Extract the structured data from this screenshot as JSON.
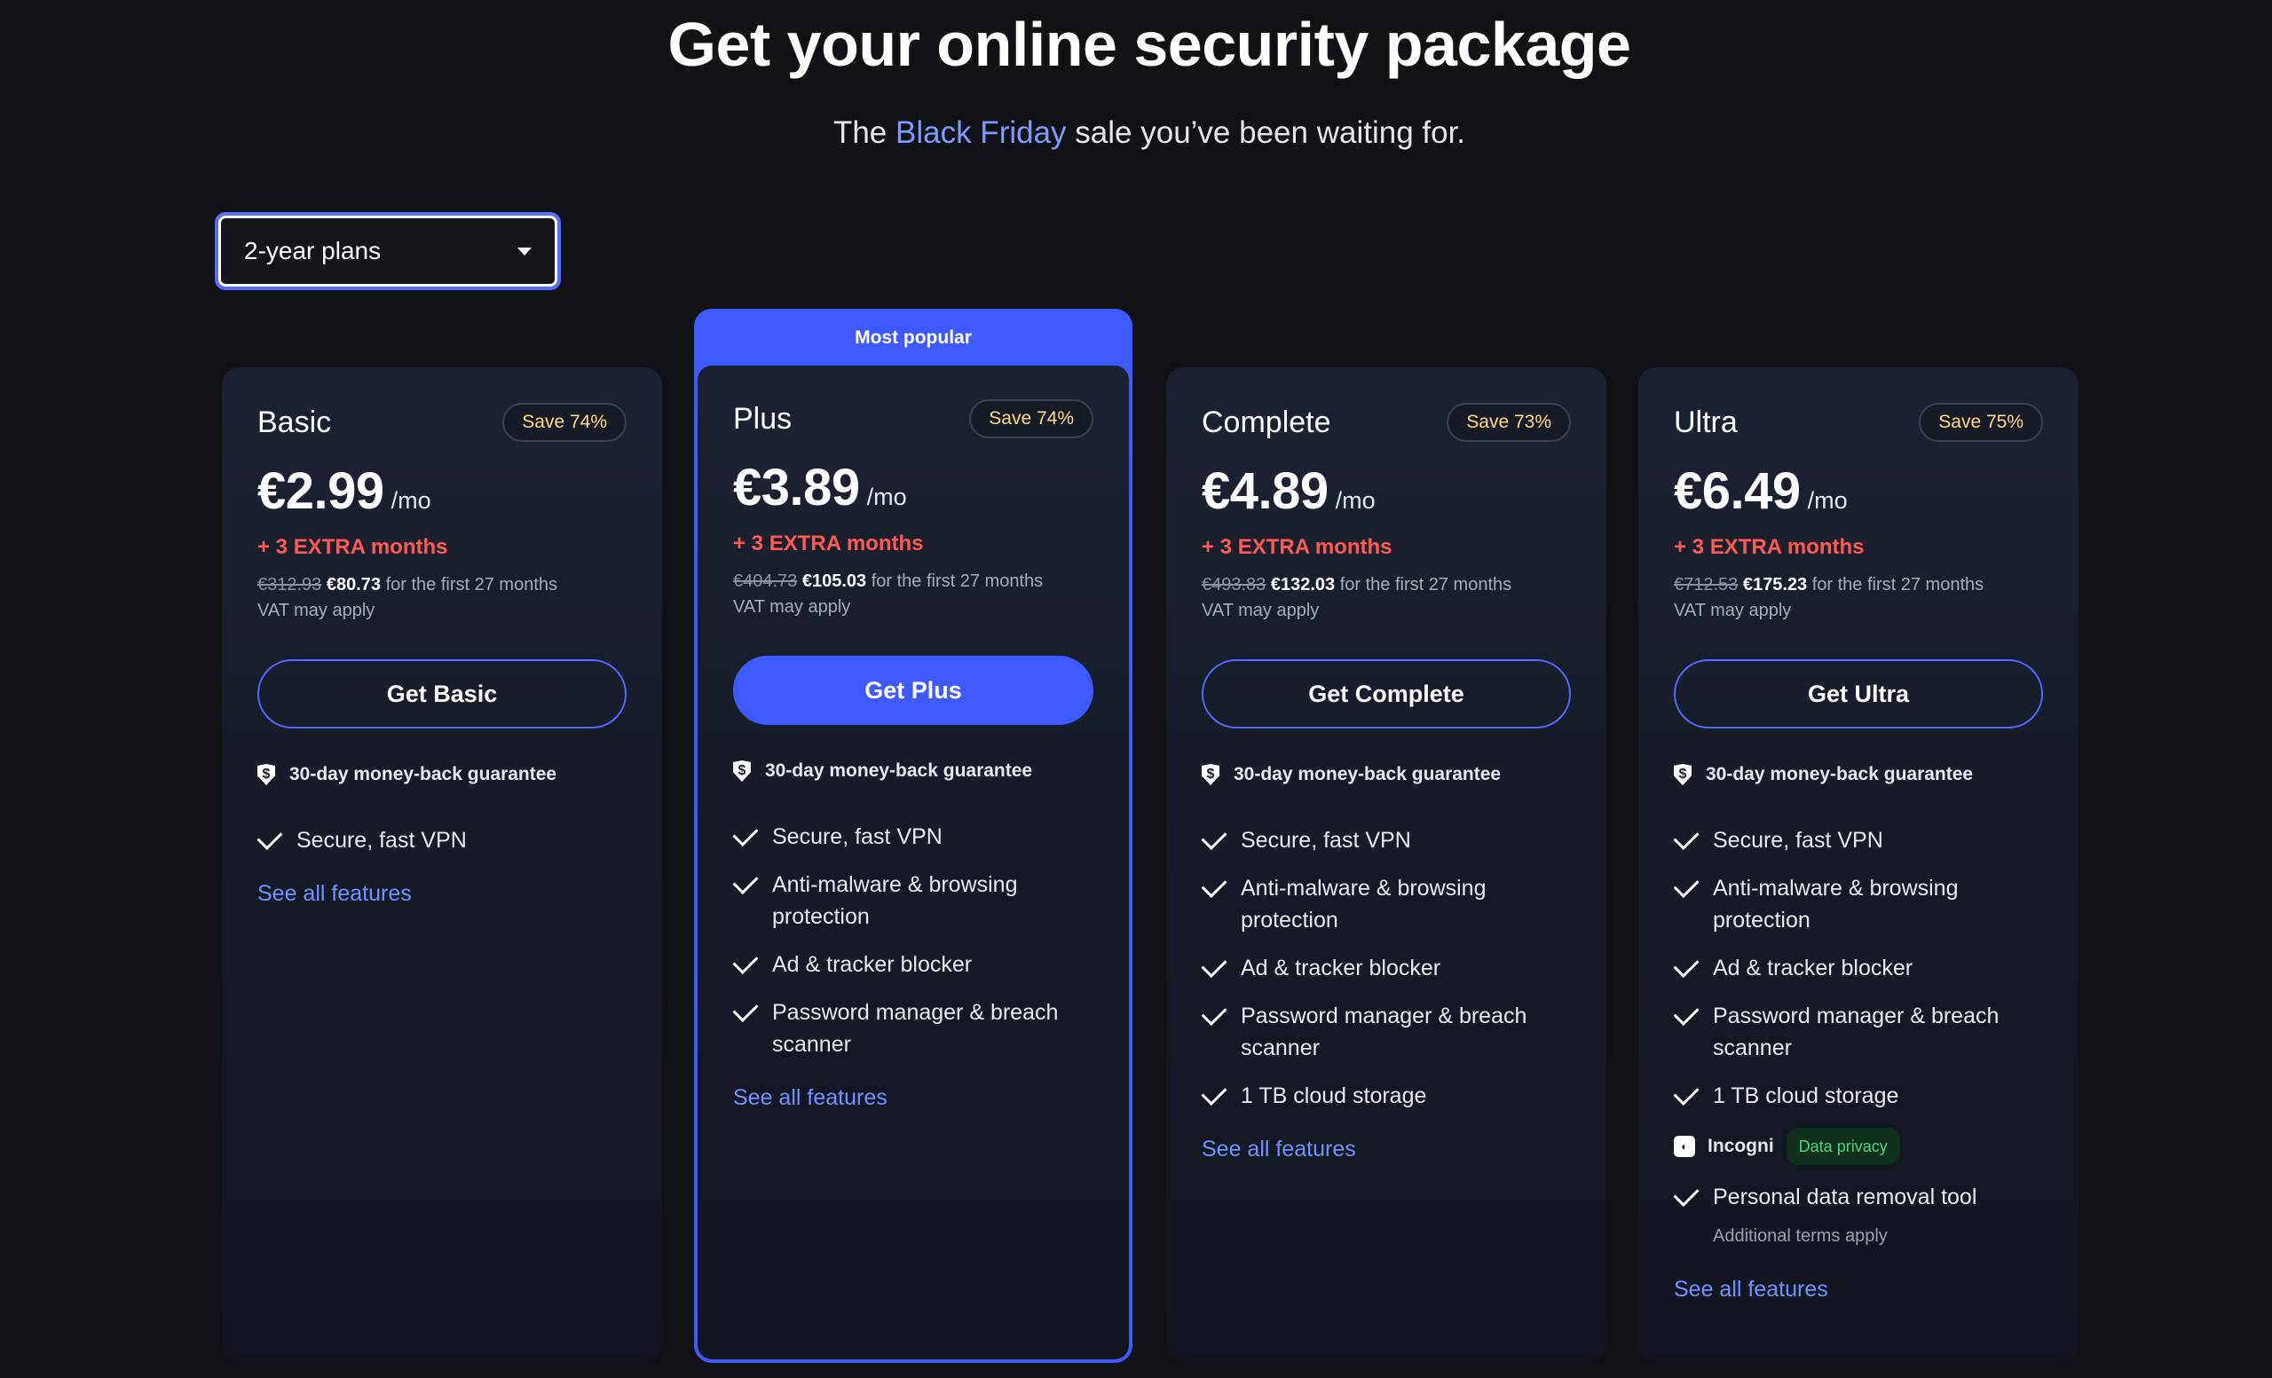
{
  "header": {
    "title": "Get your online security package",
    "subtitle_pre": "The",
    "subtitle_accent": "Black Friday",
    "subtitle_post": "sale you’ve been waiting for."
  },
  "plan_selector": {
    "value": "2-year plans"
  },
  "guarantee_text": "30-day money-back guarantee",
  "see_all_label": "See all features",
  "popular_label": "Most popular",
  "plans": [
    {
      "name": "Basic",
      "save": "Save 74%",
      "price": "€2.99",
      "per": "/mo",
      "extra": "+ 3 EXTRA months",
      "old_total": "€312.93",
      "new_total": "€80.73",
      "period": "for the first 27 months",
      "vat": "VAT may apply",
      "cta": "Get Basic",
      "features": [
        "Secure, fast VPN"
      ]
    },
    {
      "name": "Plus",
      "save": "Save 74%",
      "price": "€3.89",
      "per": "/mo",
      "extra": "+ 3 EXTRA months",
      "old_total": "€404.73",
      "new_total": "€105.03",
      "period": "for the first 27 months",
      "vat": "VAT may apply",
      "cta": "Get Plus",
      "features": [
        "Secure, fast VPN",
        "Anti-malware & browsing protection",
        "Ad & tracker blocker",
        "Password manager & breach scanner"
      ]
    },
    {
      "name": "Complete",
      "save": "Save 73%",
      "price": "€4.89",
      "per": "/mo",
      "extra": "+ 3 EXTRA months",
      "old_total": "€493.83",
      "new_total": "€132.03",
      "period": "for the first 27 months",
      "vat": "VAT may apply",
      "cta": "Get Complete",
      "features": [
        "Secure, fast VPN",
        "Anti-malware & browsing protection",
        "Ad & tracker blocker",
        "Password manager & breach scanner",
        "1 TB cloud storage"
      ]
    },
    {
      "name": "Ultra",
      "save": "Save 75%",
      "price": "€6.49",
      "per": "/mo",
      "extra": "+ 3 EXTRA months",
      "old_total": "€712.53",
      "new_total": "€175.23",
      "period": "for the first 27 months",
      "vat": "VAT may apply",
      "cta": "Get Ultra",
      "features": [
        "Secure, fast VPN",
        "Anti-malware & browsing protection",
        "Ad & tracker blocker",
        "Password manager & breach scanner",
        "1 TB cloud storage"
      ],
      "addon": {
        "brand": "Incogni",
        "tag": "Data privacy",
        "feature": "Personal data removal tool",
        "note": "Additional terms apply"
      }
    }
  ],
  "colors": {
    "accent": "#3d5afe",
    "extra_red": "#ff5a52",
    "link": "#6c93ff",
    "save_text": "#ffd98a"
  },
  "icons": [
    "chevron-down-icon",
    "shield-icon",
    "check-icon",
    "incogni-logo-icon"
  ]
}
